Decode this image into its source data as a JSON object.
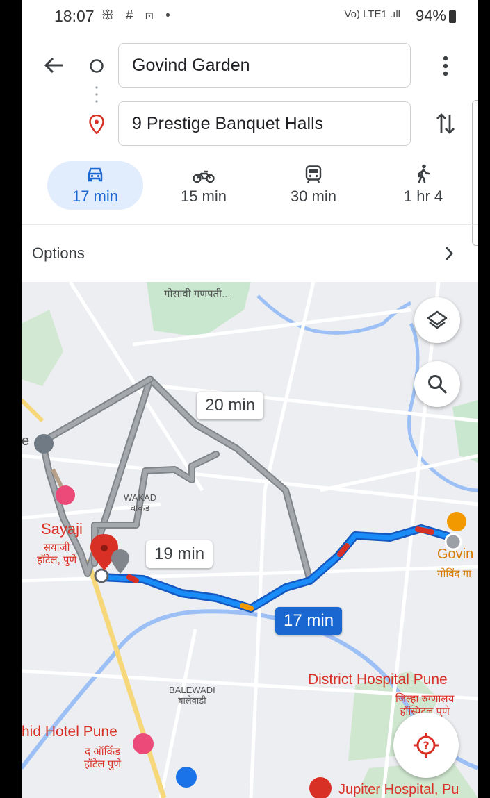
{
  "status_bar": {
    "time": "18:07",
    "left_icons": "ꕥ # ⊡ •",
    "network": "Vo) LTE1 .ıll",
    "battery": "94%"
  },
  "header": {
    "origin": "Govind Garden",
    "destination": "9 Prestige Banquet Halls"
  },
  "modes": [
    {
      "icon": "car-icon",
      "label": "17 min",
      "active": true
    },
    {
      "icon": "motorcycle-icon",
      "label": "15 min"
    },
    {
      "icon": "transit-icon",
      "label": "30 min"
    },
    {
      "icon": "walk-icon",
      "label": "1 hr 4"
    }
  ],
  "options": {
    "label": "Options"
  },
  "map": {
    "labels": {
      "top_area": "गोसावी गणपती...",
      "wakad": "WAKAD\nवाकड",
      "sayaji": "Sayaji",
      "sayaji_mr": "सयाजी\nहॉटेल, पुणे",
      "govind": "Govin",
      "govind_mr": "गोविंद गा",
      "balewadi": "BALEWADI\nबालेवाडी",
      "district_hospital": "District Hospital Pune",
      "district_hospital_mr": "जिल्हा रुग्णालय\nहॉस्पिटल पुणे",
      "orchid": "hid Hotel Pune",
      "orchid_mr": "द ऑर्किड\nहॉटेल पुणे",
      "jupiter": "Jupiter Hospital, Pu",
      "left_edge": "e"
    },
    "route_times": {
      "alt1": "20 min",
      "alt2": "19 min",
      "main": "17 min"
    },
    "colors": {
      "route_main": "#1a73e8",
      "route_alt": "#9aa0a6",
      "water": "#8ab4f8",
      "park": "#c8e6c9",
      "traffic_red": "#d93025"
    }
  }
}
